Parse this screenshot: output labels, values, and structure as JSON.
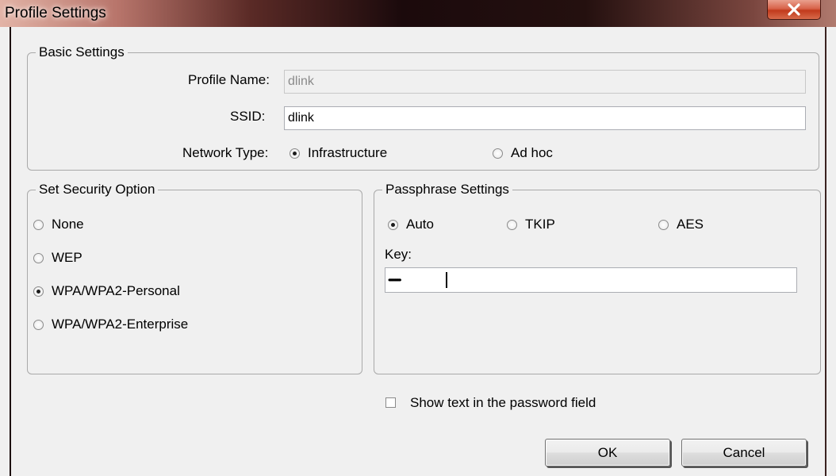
{
  "window": {
    "title": "Profile Settings",
    "close_icon": "close-icon"
  },
  "basic_settings": {
    "legend": "Basic Settings",
    "profile_name_label": "Profile Name:",
    "profile_name_value": "dlink",
    "ssid_label": "SSID:",
    "ssid_value": "dlink",
    "network_type_label": "Network Type:",
    "network_types": [
      {
        "label": "Infrastructure",
        "selected": true
      },
      {
        "label": "Ad hoc",
        "selected": false
      }
    ]
  },
  "security": {
    "legend": "Set Security Option",
    "options": [
      {
        "label": "None",
        "selected": false
      },
      {
        "label": "WEP",
        "selected": false
      },
      {
        "label": "WPA/WPA2-Personal",
        "selected": true
      },
      {
        "label": "WPA/WPA2-Enterprise",
        "selected": false
      }
    ]
  },
  "passphrase": {
    "legend": "Passphrase Settings",
    "ciphers": [
      {
        "label": "Auto",
        "selected": true
      },
      {
        "label": "TKIP",
        "selected": false
      },
      {
        "label": "AES",
        "selected": false
      }
    ],
    "key_label": "Key:",
    "key_value": "••••••••••••"
  },
  "show_text": {
    "label": "Show text in the password field",
    "checked": false
  },
  "buttons": {
    "ok": "OK",
    "cancel": "Cancel"
  },
  "colors": {
    "close_button": "#c13a1c",
    "disabled_field": "#f0f0f0"
  }
}
